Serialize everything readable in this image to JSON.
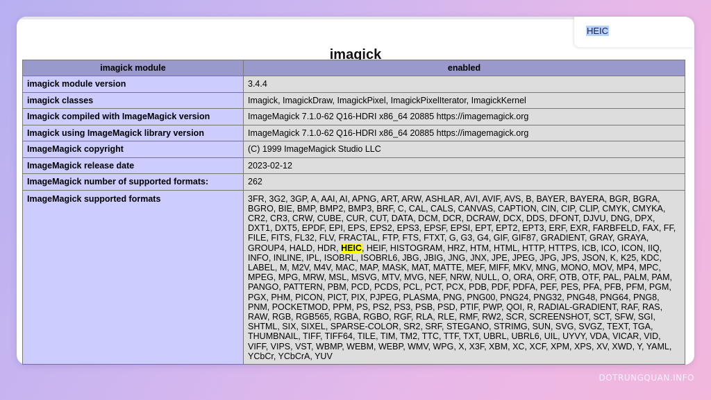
{
  "page": {
    "title": "imagick",
    "find_bar_text": "HEIC",
    "watermark": "DOTRUNGQUAN.INFO"
  },
  "table": {
    "header": [
      "imagick module",
      "enabled"
    ],
    "rows": [
      {
        "key": "imagick module version",
        "value": "3.4.4"
      },
      {
        "key": "imagick classes",
        "value": "Imagick, ImagickDraw, ImagickPixel, ImagickPixelIterator, ImagickKernel"
      },
      {
        "key": "Imagick compiled with ImageMagick version",
        "value": "ImageMagick 7.1.0-62 Q16-HDRI x86_64 20885 https://imagemagick.org"
      },
      {
        "key": "Imagick using ImageMagick library version",
        "value": "ImageMagick 7.1.0-62 Q16-HDRI x86_64 20885 https://imagemagick.org"
      },
      {
        "key": "ImageMagick copyright",
        "value": "(C) 1999 ImageMagick Studio LLC"
      },
      {
        "key": "ImageMagick release date",
        "value": "2023-02-12"
      },
      {
        "key": "ImageMagick number of supported formats:",
        "value": "262"
      }
    ],
    "formats_row": {
      "key": "ImageMagick supported formats",
      "before_highlight": "3FR, 3G2, 3GP, A, AAI, AI, APNG, ART, ARW, ASHLAR, AVI, AVIF, AVS, B, BAYER, BAYERA, BGR, BGRA, BGRO, BIE, BMP, BMP2, BMP3, BRF, C, CAL, CALS, CANVAS, CAPTION, CIN, CIP, CLIP, CMYK, CMYKA, CR2, CR3, CRW, CUBE, CUR, CUT, DATA, DCM, DCR, DCRAW, DCX, DDS, DFONT, DJVU, DNG, DPX, DXT1, DXT5, EPDF, EPI, EPS, EPS2, EPS3, EPSF, EPSI, EPT, EPT2, EPT3, ERF, EXR, FARBFELD, FAX, FF, FILE, FITS, FL32, FLV, FRACTAL, FTP, FTS, FTXT, G, G3, G4, GIF, GIF87, GRADIENT, GRAY, GRAYA, GROUP4, HALD, HDR, ",
      "highlight": "HEIC",
      "after_highlight": ", HEIF, HISTOGRAM, HRZ, HTM, HTML, HTTP, HTTPS, ICB, ICO, ICON, IIQ, INFO, INLINE, IPL, ISOBRL, ISOBRL6, JBG, JBIG, JNG, JNX, JPE, JPEG, JPG, JPS, JSON, K, K25, KDC, LABEL, M, M2V, M4V, MAC, MAP, MASK, MAT, MATTE, MEF, MIFF, MKV, MNG, MONO, MOV, MP4, MPC, MPEG, MPG, MRW, MSL, MSVG, MTV, MVG, NEF, NRW, NULL, O, ORA, ORF, OTB, OTF, PAL, PALM, PAM, PANGO, PATTERN, PBM, PCD, PCDS, PCL, PCT, PCX, PDB, PDF, PDFA, PEF, PES, PFA, PFB, PFM, PGM, PGX, PHM, PICON, PICT, PIX, PJPEG, PLASMA, PNG, PNG00, PNG24, PNG32, PNG48, PNG64, PNG8, PNM, POCKETMOD, PPM, PS, PS2, PS3, PSB, PSD, PTIF, PWP, QOI, R, RADIAL-GRADIENT, RAF, RAS, RAW, RGB, RGB565, RGBA, RGBO, RGF, RLA, RLE, RMF, RW2, SCR, SCREENSHOT, SCT, SFW, SGI, SHTML, SIX, SIXEL, SPARSE-COLOR, SR2, SRF, STEGANO, STRIMG, SUN, SVG, SVGZ, TEXT, TGA, THUMBNAIL, TIFF, TIFF64, TILE, TIM, TM2, TTC, TTF, TXT, UBRL, UBRL6, UIL, UYVY, VDA, VICAR, VID, VIFF, VIPS, VST, WBMP, WEBM, WEBP, WMV, WPG, X, X3F, XBM, XC, XCF, XPM, XPS, XV, XWD, Y, YAML, YCbCr, YCbCrA, YUV"
    }
  },
  "colors": {
    "header_bg": "#9999cc",
    "key_bg": "#ccccff",
    "value_bg": "#dddddd",
    "highlight": "#ffff00",
    "find_selection": "#b4d4fb"
  }
}
